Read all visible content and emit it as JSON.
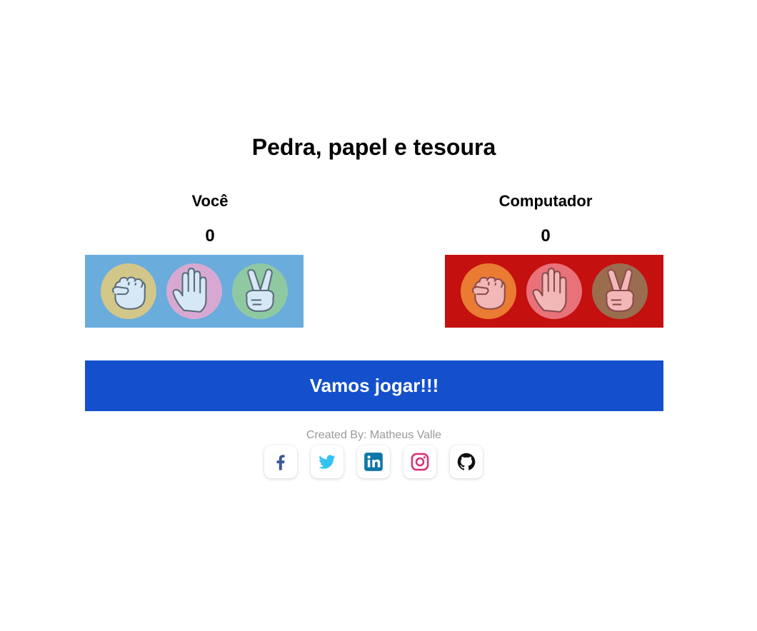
{
  "title": "Pedra, papel e tesoura",
  "player": {
    "name": "Você",
    "score": "0",
    "panel_color": "#6aacdc",
    "choices": [
      {
        "icon": "rock-hand-icon",
        "circle_color": "#d2c789"
      },
      {
        "icon": "paper-hand-icon",
        "circle_color": "#d7a9d2"
      },
      {
        "icon": "scissors-hand-icon",
        "circle_color": "#8fc9a1"
      }
    ]
  },
  "computer": {
    "name": "Computador",
    "score": "0",
    "panel_color": "#c4100f",
    "choices": [
      {
        "icon": "rock-hand-icon",
        "circle_color": "#ea7b33"
      },
      {
        "icon": "paper-hand-icon",
        "circle_color": "#e9727a"
      },
      {
        "icon": "scissors-hand-icon",
        "circle_color": "#9a6d4e"
      }
    ]
  },
  "play_button": {
    "label": "Vamos jogar!!!",
    "color": "#1450cc"
  },
  "footer": {
    "credit": "Created By: Matheus Valle",
    "socials": [
      {
        "icon": "facebook-icon",
        "color": "#3b5998"
      },
      {
        "icon": "twitter-icon",
        "color": "#33c3f0"
      },
      {
        "icon": "linkedin-icon",
        "color": "#0e76a8"
      },
      {
        "icon": "instagram-icon",
        "color": "#d6337a"
      },
      {
        "icon": "github-icon",
        "color": "#111111"
      }
    ]
  }
}
